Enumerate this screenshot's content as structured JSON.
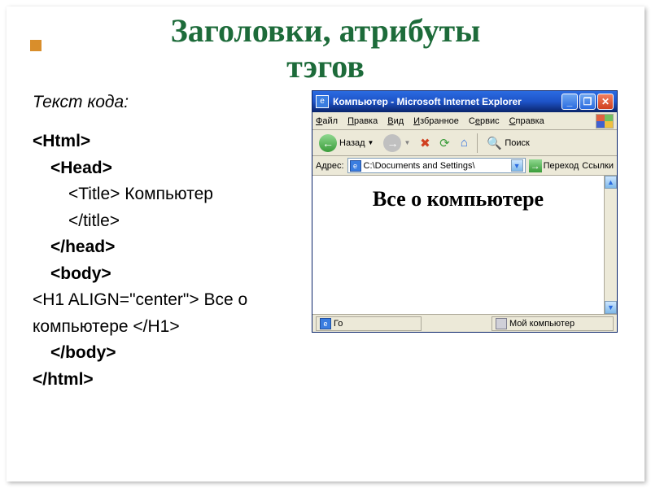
{
  "slide": {
    "title_line1": "Заголовки, атрибуты",
    "title_line2": "тэгов",
    "code_label": "Текст кода:",
    "code": {
      "l1": "<Html>",
      "l2": "<Head>",
      "l3a": "<Title>",
      "l3b": " Компьютер ",
      "l3c": "</title>",
      "l4": "</head>",
      "l5": "<body>",
      "l6a": "<H1 ALIGN=\"center\">",
      "l6b": " Все о компьютере ",
      "l6c": "</H1>",
      "l7": "</body>",
      "l8": "</html>"
    }
  },
  "browser": {
    "title": "Компьютер - Microsoft Internet Explorer",
    "menu": {
      "file": "Файл",
      "edit": "Правка",
      "view": "Вид",
      "fav": "Избранное",
      "tools": "Сервис",
      "help": "Справка"
    },
    "toolbar": {
      "back": "Назад",
      "search": "Поиск"
    },
    "address": {
      "label": "Адрес:",
      "path": "C:\\Documents and Settings\\",
      "go": "Переход",
      "links": "Ссылки"
    },
    "page_heading": "Все о компьютере",
    "status": {
      "left": "Го",
      "zone": "Мой компьютер"
    }
  }
}
